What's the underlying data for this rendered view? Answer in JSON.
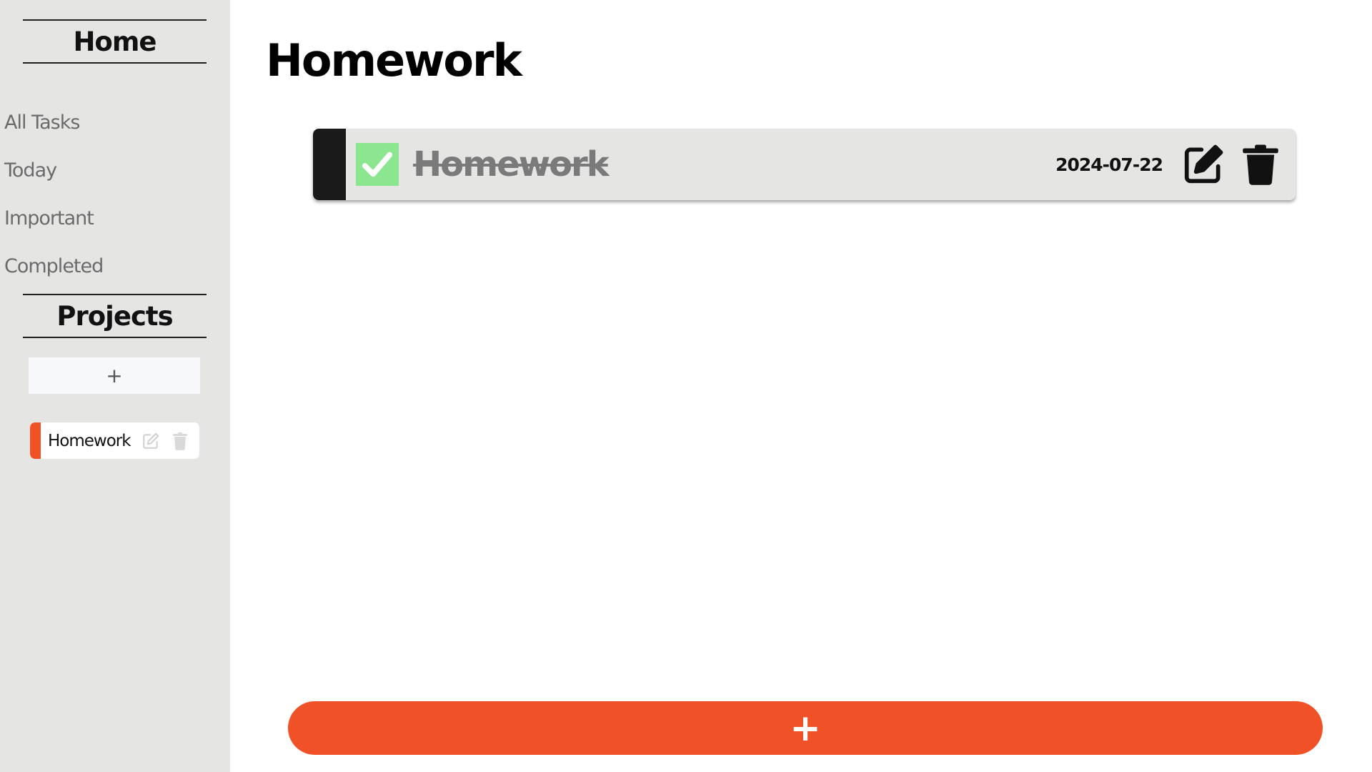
{
  "sidebar": {
    "home_heading": "Home",
    "nav_items": [
      {
        "label": "All Tasks"
      },
      {
        "label": "Today"
      },
      {
        "label": "Important"
      },
      {
        "label": "Completed"
      }
    ],
    "projects_heading": "Projects",
    "add_project_label": "+",
    "projects": [
      {
        "name": "Homework",
        "accent_color": "#f05127",
        "icons": [
          "edit-icon",
          "trash-icon"
        ]
      }
    ]
  },
  "main": {
    "title": "Homework",
    "tasks": [
      {
        "title": "Homework",
        "completed": true,
        "due_date": "2024-07-22",
        "priority_color": "#1a1a1a",
        "icons": [
          "edit-icon",
          "trash-icon"
        ]
      }
    ],
    "add_task_label": "+"
  },
  "colors": {
    "accent": "#f05127",
    "sidebar_bg": "#e5e6e4",
    "check_green": "#8ce68f"
  }
}
